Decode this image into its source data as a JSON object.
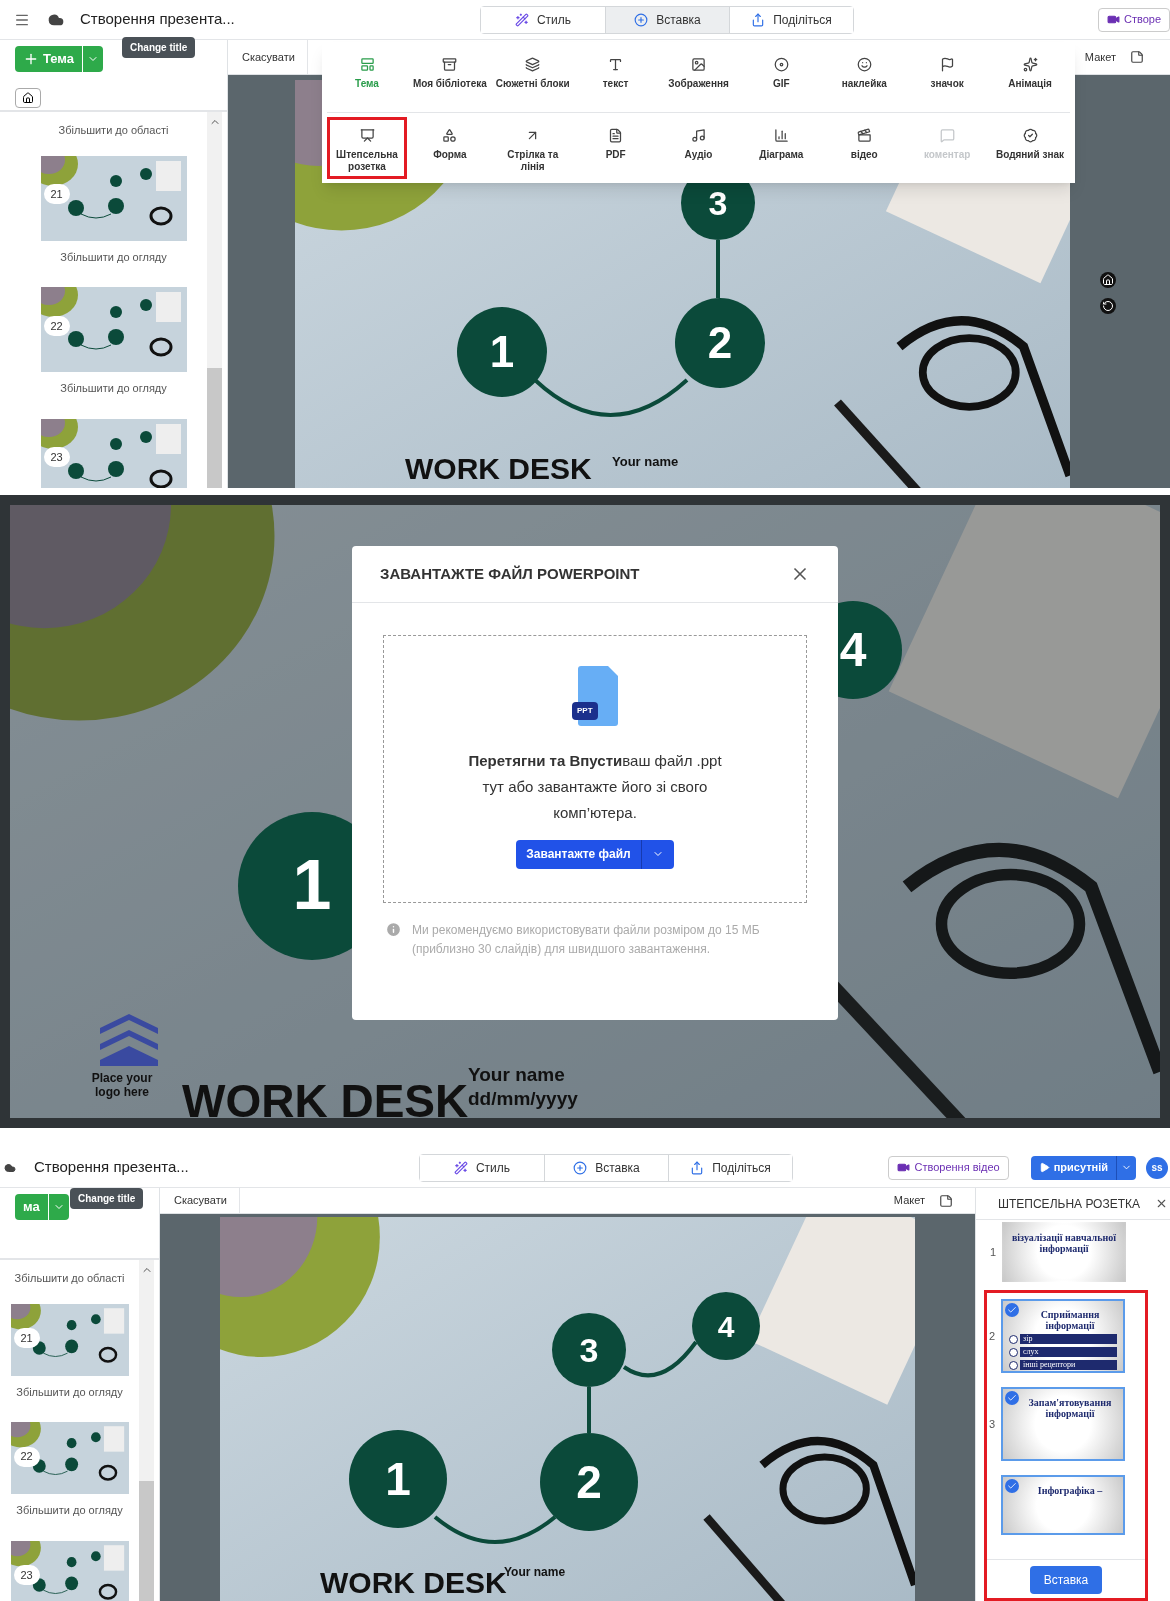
{
  "editor_insert_menu": {
    "header": {
      "document_title": "Створення презента...",
      "tooltip": "Change title",
      "tabs": [
        {
          "label": "Стиль",
          "selected": false
        },
        {
          "label": "Вставка",
          "selected": true
        },
        {
          "label": "Поділіться",
          "selected": false
        }
      ],
      "video_button": "Створе"
    },
    "sidebar": {
      "topic_button": "Тема",
      "top_caption": "Збільшити до області",
      "slides": [
        {
          "number": "21",
          "caption": "Збільшити до огляду"
        },
        {
          "number": "22",
          "caption": "Збільшити до огляду"
        },
        {
          "number": "23"
        }
      ]
    },
    "toolbar": {
      "undo": "Скасувати",
      "layout": "Макет"
    },
    "insert_menu": [
      [
        {
          "label": "Тема",
          "selected": true,
          "disabled": false,
          "highlighted": false
        },
        {
          "label": "Моя бібліотека",
          "selected": false,
          "disabled": false,
          "highlighted": false
        },
        {
          "label": "Сюжетні блоки",
          "selected": false,
          "disabled": false,
          "highlighted": false
        },
        {
          "label": "текст",
          "selected": false,
          "disabled": false,
          "highlighted": false
        },
        {
          "label": "Зображення",
          "selected": false,
          "disabled": false,
          "highlighted": false
        },
        {
          "label": "GIF",
          "selected": false,
          "disabled": false,
          "highlighted": false
        },
        {
          "label": "наклейка",
          "selected": false,
          "disabled": false,
          "highlighted": false
        },
        {
          "label": "значок",
          "selected": false,
          "disabled": false,
          "highlighted": false
        },
        {
          "label": "Анімація",
          "selected": false,
          "disabled": false,
          "highlighted": false
        }
      ],
      [
        {
          "label": "Штепсельна розетка",
          "selected": false,
          "disabled": false,
          "highlighted": true
        },
        {
          "label": "Форма",
          "selected": false,
          "disabled": false,
          "highlighted": false
        },
        {
          "label": "Стрілка та лінія",
          "selected": false,
          "disabled": false,
          "highlighted": false
        },
        {
          "label": "PDF",
          "selected": false,
          "disabled": false,
          "highlighted": false
        },
        {
          "label": "Аудіо",
          "selected": false,
          "disabled": false,
          "highlighted": false
        },
        {
          "label": "Діаграма",
          "selected": false,
          "disabled": false,
          "highlighted": false
        },
        {
          "label": "відео",
          "selected": false,
          "disabled": false,
          "highlighted": false
        },
        {
          "label": "коментар",
          "selected": false,
          "disabled": true,
          "highlighted": false
        },
        {
          "label": "Водяний знак",
          "selected": false,
          "disabled": false,
          "highlighted": false
        }
      ]
    ],
    "slide": {
      "steps": [
        "1",
        "2",
        "3"
      ],
      "brand": "WORK DESK",
      "name": "Your name"
    }
  },
  "upload_dialog_screen": {
    "slide": {
      "steps": [
        "1",
        "4"
      ],
      "logo_caption": "Place your logo here",
      "brand": "WORK DESK",
      "name": "Your name",
      "date": "dd/mm/yyyy"
    },
    "dialog": {
      "title": "ЗАВАНТАЖТЕ ФАЙЛ POWERPOINT",
      "file_badge": "PPT",
      "drop_text": "**Перетягни та Впусти**ваш файл .ppt тут або завантажте його зі свого комп’ютера.",
      "upload_button": "Завантажте файл",
      "note": "Ми рекомендуємо використовувати файли розміром до 15 МБ (приблизно 30 слайдів) для швидшого завантаження."
    }
  },
  "editor_import_panel": {
    "header": {
      "document_title": "Створення презента...",
      "tooltip": "Change title",
      "tabs": [
        {
          "label": "Стиль",
          "selected": false
        },
        {
          "label": "Вставка",
          "selected": false
        },
        {
          "label": "Поділіться",
          "selected": false
        }
      ],
      "video_button": "Створення відео",
      "present_button": "присутній",
      "avatar": "ss"
    },
    "sidebar": {
      "topic_button": "ма",
      "top_caption": "Збільшити до області",
      "slides": [
        {
          "number": "21",
          "caption": "Збільшити до огляду"
        },
        {
          "number": "22",
          "caption": "Збільшити до огляду"
        },
        {
          "number": "23"
        }
      ]
    },
    "toolbar": {
      "undo": "Скасувати",
      "layout": "Макет"
    },
    "slide": {
      "steps": [
        "1",
        "2",
        "3",
        "4"
      ],
      "brand": "WORK DESK",
      "name": "Your name"
    },
    "import_panel": {
      "title": "ШТЕПСЕЛЬНА РОЗЕТКА",
      "highlight_frame": true,
      "slides": [
        {
          "number": "1",
          "title": "візуалізації навчальної інформації",
          "checked": false
        },
        {
          "number": "2",
          "title": "Сприймання інформації",
          "bars": [
            "зір",
            "слух",
            "інші рецептори"
          ],
          "checked": true
        },
        {
          "number": "3",
          "title": "Запам'ятовування інформації",
          "checked": true
        },
        {
          "title": "Інфографіка –",
          "checked": true
        }
      ],
      "insert_button": "Вставка"
    }
  }
}
